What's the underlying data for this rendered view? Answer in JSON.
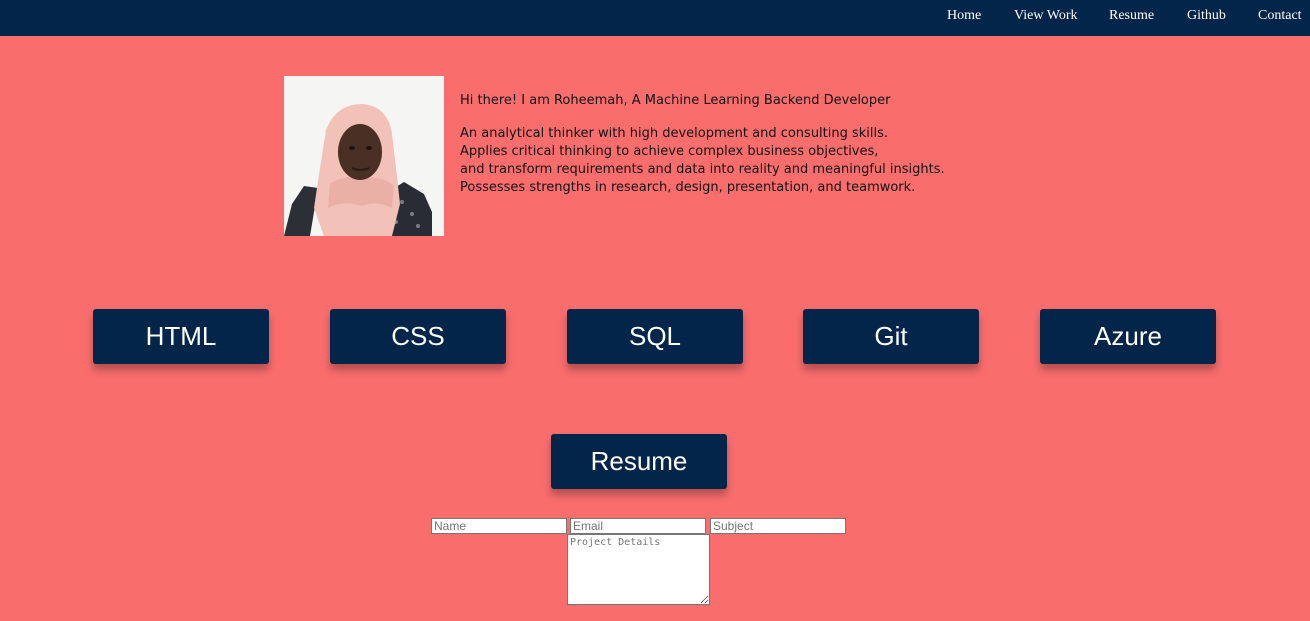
{
  "nav": {
    "items": [
      {
        "label": "Home"
      },
      {
        "label": "View Work"
      },
      {
        "label": "Resume"
      },
      {
        "label": "Github"
      },
      {
        "label": "Contact"
      }
    ]
  },
  "profile": {
    "headline": "Hi there! I am Roheemah, A Machine Learning Backend Developer",
    "lines": [
      "An analytical thinker with high development and consulting skills.",
      "Applies critical thinking to achieve complex business objectives,",
      "and transform requirements and data into reality and meaningful insights.",
      "Possesses strengths in research, design, presentation, and teamwork."
    ]
  },
  "skills": [
    "HTML",
    "CSS",
    "SQL",
    "Git",
    "Azure"
  ],
  "resume_button": {
    "label": "Resume"
  },
  "contact_form": {
    "name_placeholder": "Name",
    "email_placeholder": "Email",
    "subject_placeholder": "Subject",
    "details_placeholder": "Project Details"
  },
  "colors": {
    "background": "#f96d6d",
    "navbar": "#032549",
    "button": "#032549",
    "button_text": "#ffffff"
  }
}
